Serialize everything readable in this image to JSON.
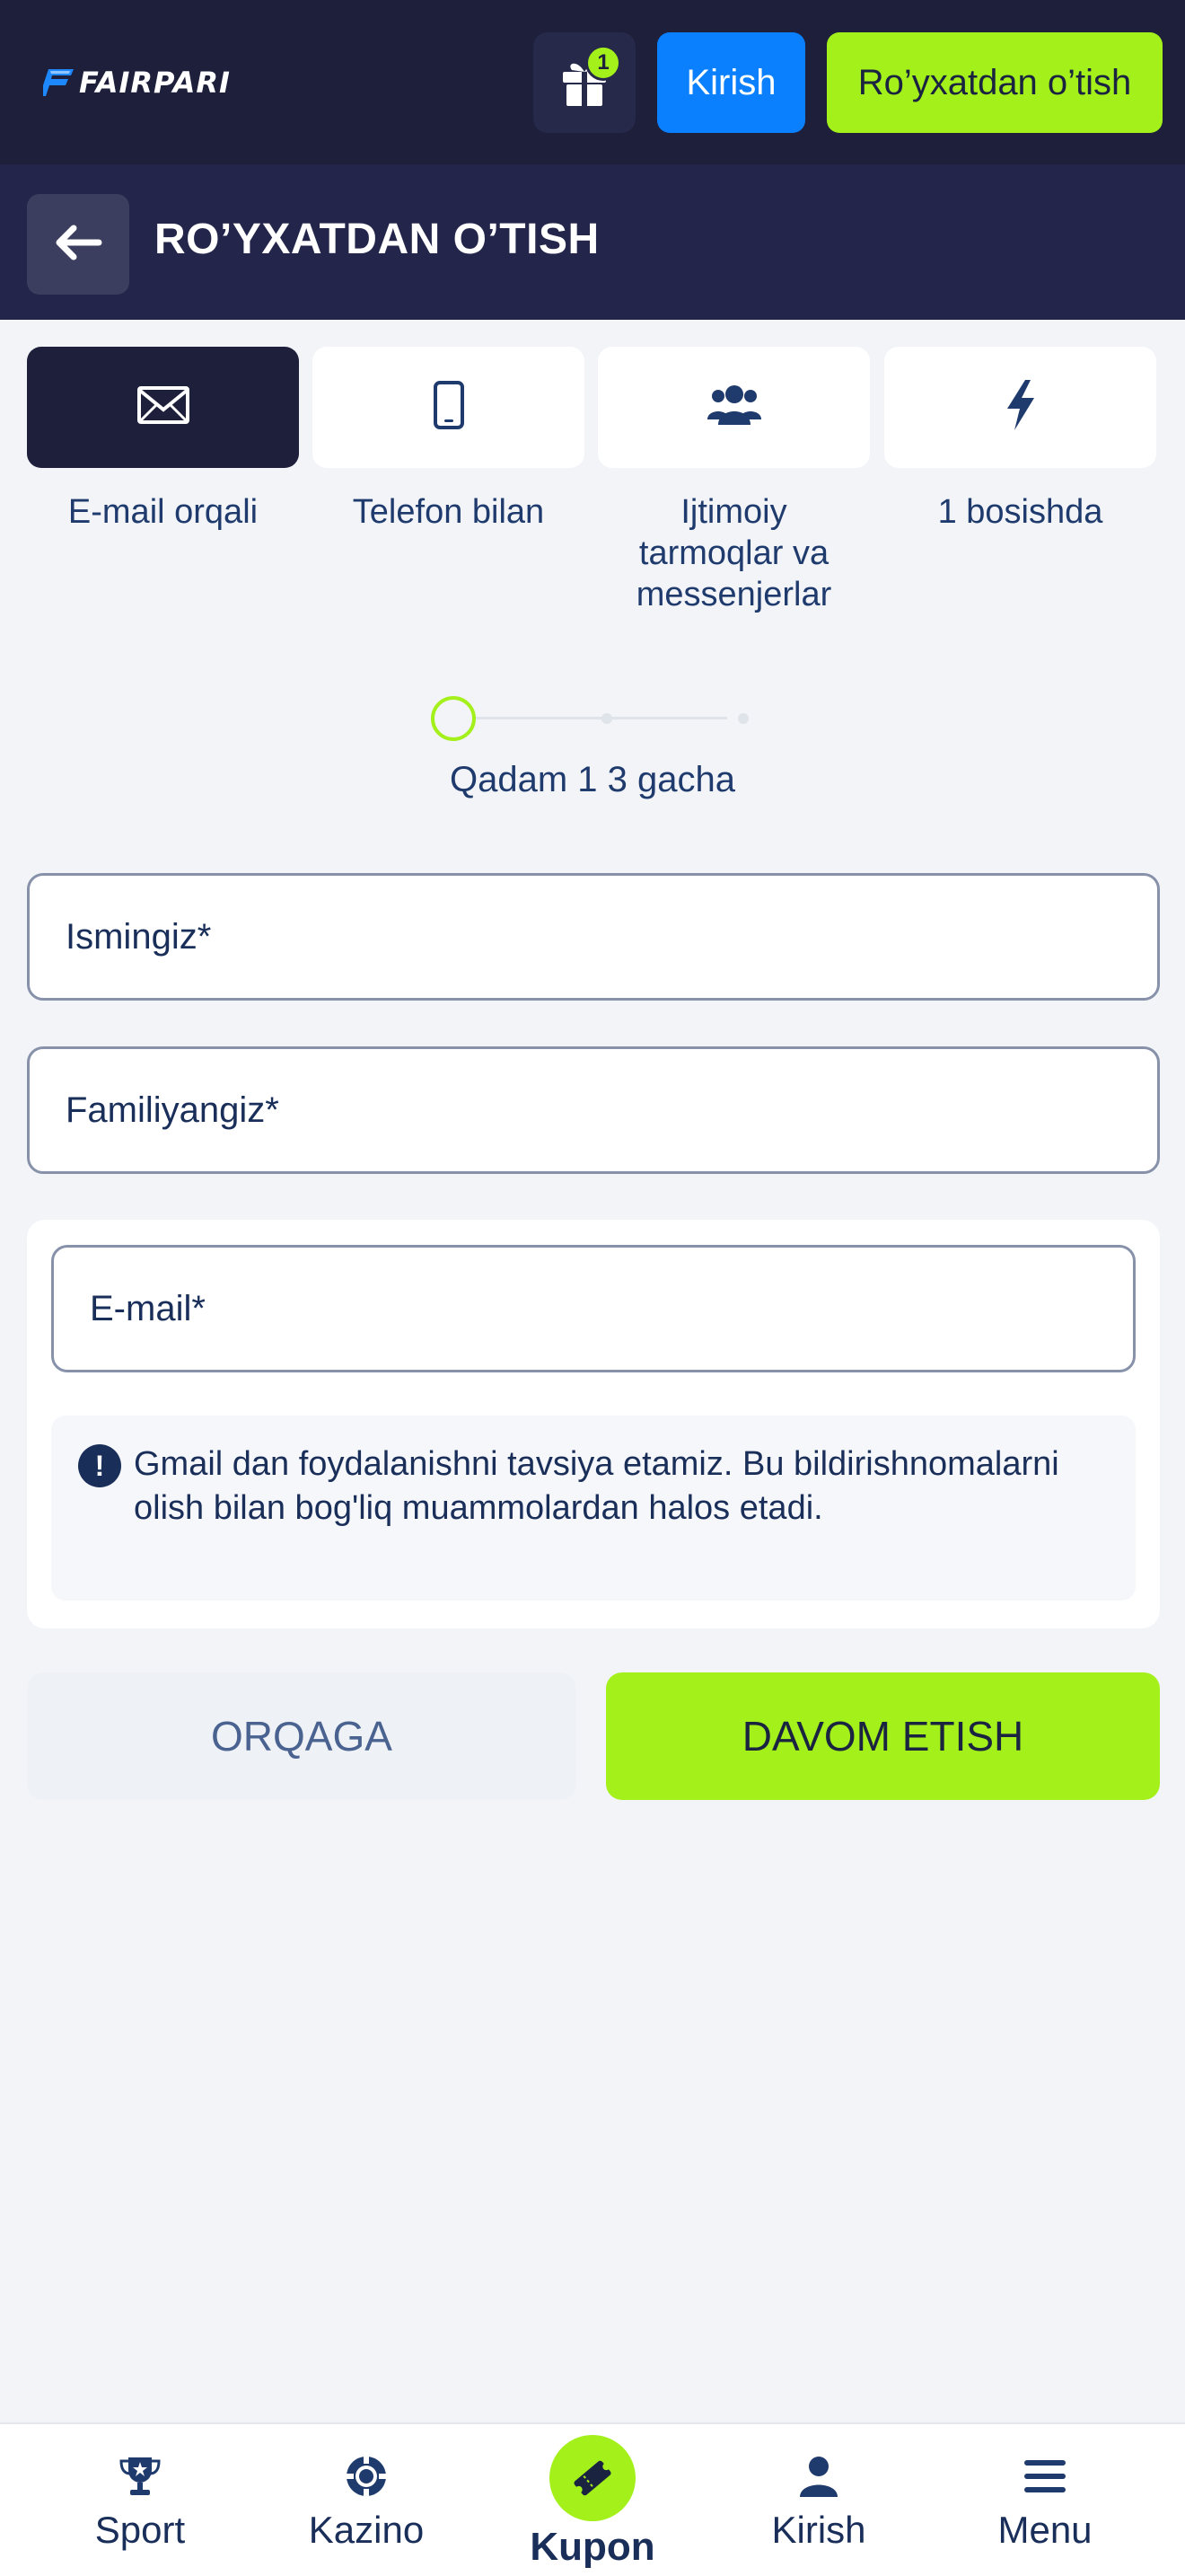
{
  "header": {
    "logo_text": "FAIRPARI",
    "gift_count": "1",
    "login_label": "Kirish",
    "register_label": "Ro’yxatdan o’tish"
  },
  "subheader": {
    "title": "RO’YXATDAN O’TISH"
  },
  "methods": [
    {
      "label": "E-mail orqali",
      "icon": "envelope-icon",
      "active": true
    },
    {
      "label": "Telefon bilan",
      "icon": "phone-icon",
      "active": false
    },
    {
      "label": "Ijtimoiy tarmoqlar va messenjerlar",
      "icon": "users-icon",
      "active": false
    },
    {
      "label": "1 bosishda",
      "icon": "lightning-icon",
      "active": false
    }
  ],
  "stepper": {
    "text": "Qadam 1 3 gacha",
    "current": 1,
    "total": 3
  },
  "form": {
    "first_name_placeholder": "Ismingiz*",
    "last_name_placeholder": "Familiyangiz*",
    "email_placeholder": "E-mail*",
    "hint": "Gmail dan foydalanishni tavsiya etamiz. Bu bildirishnomalarni olish bilan bog'liq muammolardan halos etadi."
  },
  "actions": {
    "back_label": "ORQAGA",
    "continue_label": "DAVOM ETISH"
  },
  "bottom_nav": {
    "sport": "Sport",
    "kazino": "Kazino",
    "kupon": "Kupon",
    "kirish": "Kirish",
    "menu": "Menu"
  },
  "colors": {
    "header_bg": "#1d1f3b",
    "subheader_bg": "#23264a",
    "accent_green": "#a3f01a",
    "accent_blue": "#0a80ff",
    "text_navy": "#1a2e5a"
  }
}
